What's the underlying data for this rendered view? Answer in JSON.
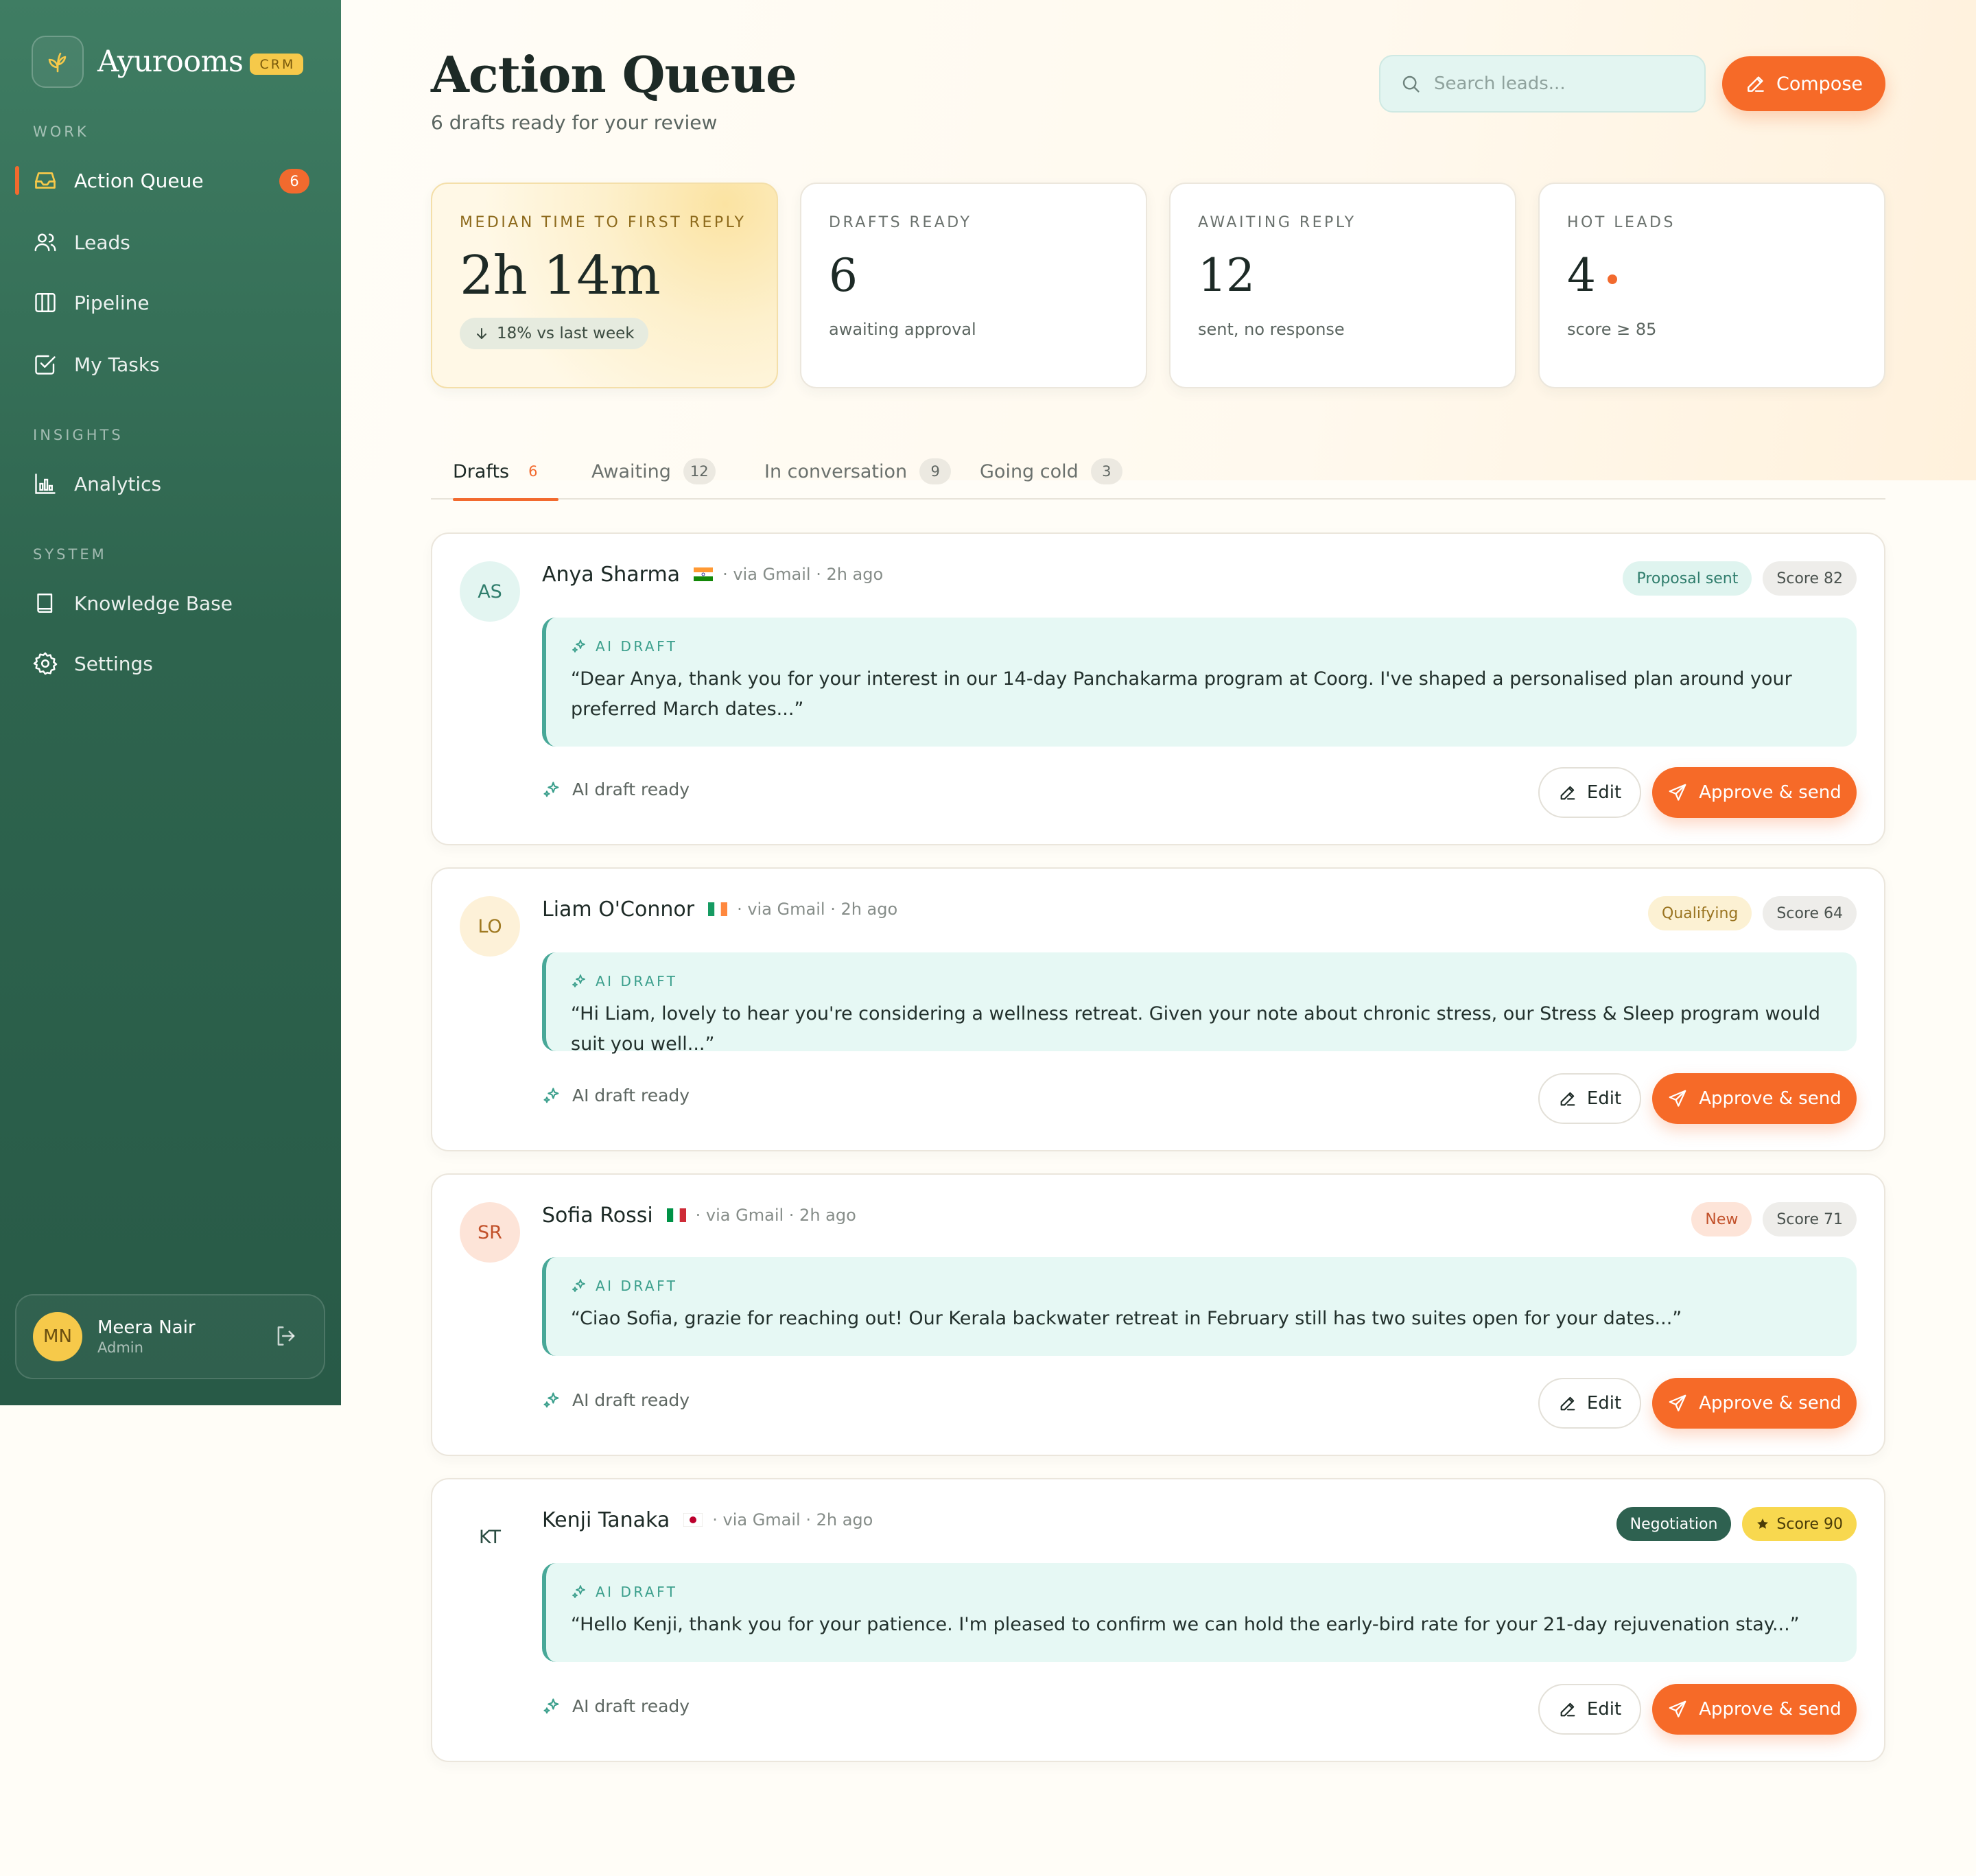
{
  "brand": {
    "name": "Ayurooms",
    "badge": "CRM"
  },
  "nav": {
    "sections": [
      "WORK",
      "INSIGHTS",
      "SYSTEM"
    ],
    "items": [
      {
        "label": "Action Queue",
        "icon": "inbox-icon",
        "count": "6"
      },
      {
        "label": "Leads",
        "icon": "users-icon"
      },
      {
        "label": "Pipeline",
        "icon": "columns-icon"
      },
      {
        "label": "My Tasks",
        "icon": "checkbox-icon"
      },
      {
        "label": "Analytics",
        "icon": "bar-chart-icon"
      },
      {
        "label": "Knowledge Base",
        "icon": "book-icon"
      },
      {
        "label": "Settings",
        "icon": "gear-icon"
      }
    ]
  },
  "user": {
    "initials": "MN",
    "name": "Meera Nair",
    "role": "Admin"
  },
  "header": {
    "title": "Action Queue",
    "subtitle": "6 drafts ready for your review",
    "search_placeholder": "Search leads...",
    "compose_label": "Compose"
  },
  "stats": [
    {
      "label": "MEDIAN TIME TO FIRST REPLY",
      "value": "2h 14m",
      "trend": "18% vs last week"
    },
    {
      "label": "DRAFTS READY",
      "value": "6",
      "note": "awaiting approval"
    },
    {
      "label": "AWAITING REPLY",
      "value": "12",
      "note": "sent, no response"
    },
    {
      "label": "HOT LEADS",
      "value": "4",
      "note": "score ≥ 85"
    }
  ],
  "tabs": [
    {
      "label": "Drafts",
      "count": "6"
    },
    {
      "label": "Awaiting",
      "count": "12"
    },
    {
      "label": "In conversation",
      "count": "9"
    },
    {
      "label": "Going cold",
      "count": "3"
    }
  ],
  "common": {
    "ai_draft_label": "AI DRAFT",
    "ready_label": "AI draft ready",
    "edit_label": "Edit",
    "send_label": "Approve & send"
  },
  "leads": [
    {
      "initials": "AS",
      "name": "Anya Sharma",
      "flag": "india",
      "meta": "· via Gmail · 2h ago",
      "stage": "Proposal sent",
      "score": "Score 82",
      "draft": "“Dear Anya, thank you for your interest in our 14-day Panchakarma program at Coorg. I've shaped a personalised plan around your preferred March dates...”",
      "colors": {
        "avatar_bg": "#e3f5f1",
        "avatar_fg": "#2f7d6c",
        "stage_bg": "#dff4ef",
        "stage_fg": "#2f7d6c"
      }
    },
    {
      "initials": "LO",
      "name": "Liam O'Connor",
      "flag": "ireland",
      "meta": "· via Gmail · 2h ago",
      "stage": "Qualifying",
      "score": "Score 64",
      "draft": "“Hi Liam, lovely to hear you're considering a wellness retreat. Given your note about chronic stress, our Stress & Sleep program would suit you well...”",
      "colors": {
        "avatar_bg": "#fdf1d8",
        "avatar_fg": "#a07a22",
        "stage_bg": "#fcf1d3",
        "stage_fg": "#9a7420"
      }
    },
    {
      "initials": "SR",
      "name": "Sofia Rossi",
      "flag": "italy",
      "meta": "· via Gmail · 2h ago",
      "stage": "New",
      "score": "Score 71",
      "draft": "“Ciao Sofia, grazie for reaching out! Our Kerala backwater retreat in February still has two suites open for your dates...”",
      "colors": {
        "avatar_bg": "#fde4d8",
        "avatar_fg": "#c2512a",
        "stage_bg": "#fde4d8",
        "stage_fg": "#c2512a"
      }
    },
    {
      "initials": "KT",
      "name": "Kenji Tanaka",
      "flag": "japan",
      "meta": "· via Gmail · 2h ago",
      "stage": "Negotiation",
      "score": "Score 90",
      "draft": "“Hello Kenji, thank you for your patience. I'm pleased to confirm we can hold the early-bird rate for your 21-day rejuvenation stay...”",
      "colors": {
        "avatar_bg": "#ffffff",
        "avatar_fg": "#2b4d42",
        "stage_bg": "#2e6150",
        "stage_fg": "#ffffff"
      }
    }
  ],
  "theme": {
    "accent": "#f66a28",
    "sidebar": "#2e644e",
    "teal": "#48a898",
    "gold": "#f6c94a"
  }
}
